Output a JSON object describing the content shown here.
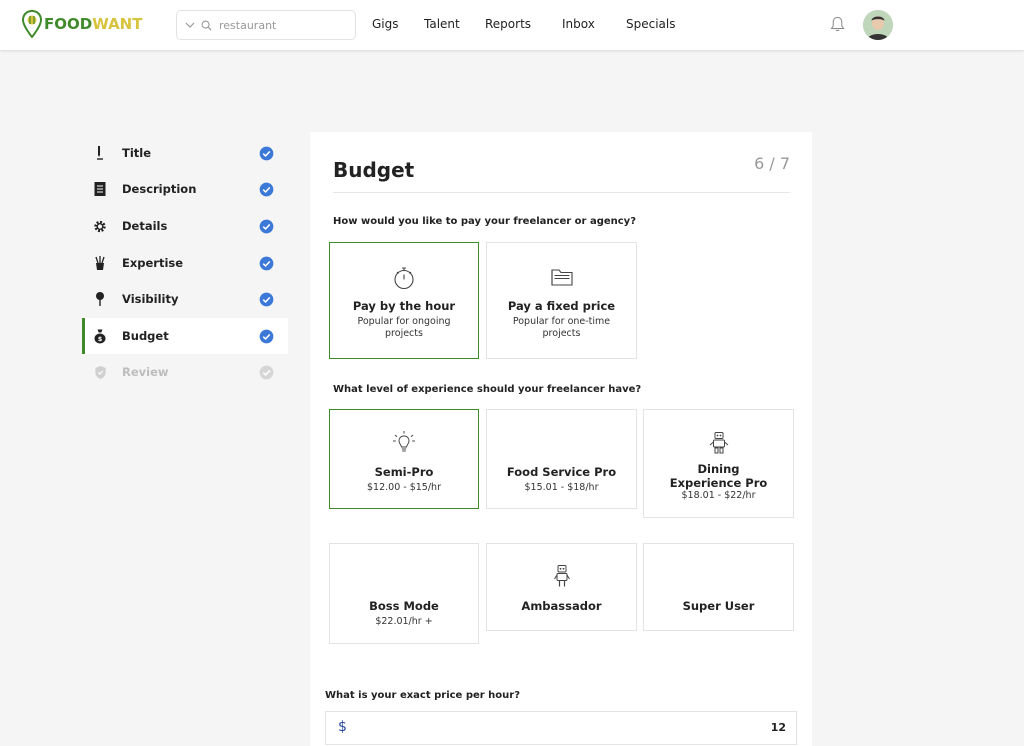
{
  "brand": {
    "part1": "FOOD",
    "part2": "WANT"
  },
  "search": {
    "value": "",
    "placeholder": "restaurant"
  },
  "nav": [
    "Gigs",
    "Talent",
    "Reports",
    "Inbox",
    "Specials"
  ],
  "sidebar": {
    "steps": [
      {
        "label": "Title",
        "icon": "pen-icon",
        "done": true
      },
      {
        "label": "Description",
        "icon": "document-icon",
        "done": true
      },
      {
        "label": "Details",
        "icon": "gear-icon",
        "done": true
      },
      {
        "label": "Expertise",
        "icon": "brushes-icon",
        "done": true
      },
      {
        "label": "Visibility",
        "icon": "pin-icon",
        "done": true
      },
      {
        "label": "Budget",
        "icon": "money-bag-icon",
        "done": true,
        "active": true
      },
      {
        "label": "Review",
        "icon": "shield-icon",
        "done": false
      }
    ]
  },
  "card": {
    "title": "Budget",
    "step": "6 / 7",
    "q1": "How would you like to pay your freelancer or agency?",
    "pay_options": [
      {
        "title": "Pay by the hour",
        "sub": "Popular for ongoing projects",
        "icon": "stopwatch-icon",
        "selected": true
      },
      {
        "title": "Pay a fixed price",
        "sub": "Popular for one-time projects",
        "icon": "folder-icon",
        "selected": false
      }
    ],
    "q2": "What level of experience should your freelancer have?",
    "levels": [
      {
        "title": "Semi-Pro",
        "sub": "$12.00 - $15/hr",
        "icon": "lightbulb-icon",
        "selected": true
      },
      {
        "title": "Food Service Pro",
        "sub": "$15.01 - $18/hr",
        "icon": "",
        "selected": false
      },
      {
        "title": "Dining Experience Pro",
        "sub": "$18.01 - $22/hr",
        "icon": "robot-icon",
        "selected": false
      },
      {
        "title": "Boss Mode",
        "sub": "$22.01/hr +",
        "icon": "",
        "selected": false
      },
      {
        "title": "Ambassador",
        "sub": "",
        "icon": "robot-small-icon",
        "selected": false
      },
      {
        "title": "Super User",
        "sub": "",
        "icon": "",
        "selected": false
      }
    ],
    "q3": "What is your exact price per hour?",
    "price": {
      "currency": "$",
      "value": "12"
    }
  },
  "colors": {
    "brand_green": "#3f8a2a",
    "brand_yellow": "#d8c33c",
    "check_blue": "#3b78d8"
  }
}
